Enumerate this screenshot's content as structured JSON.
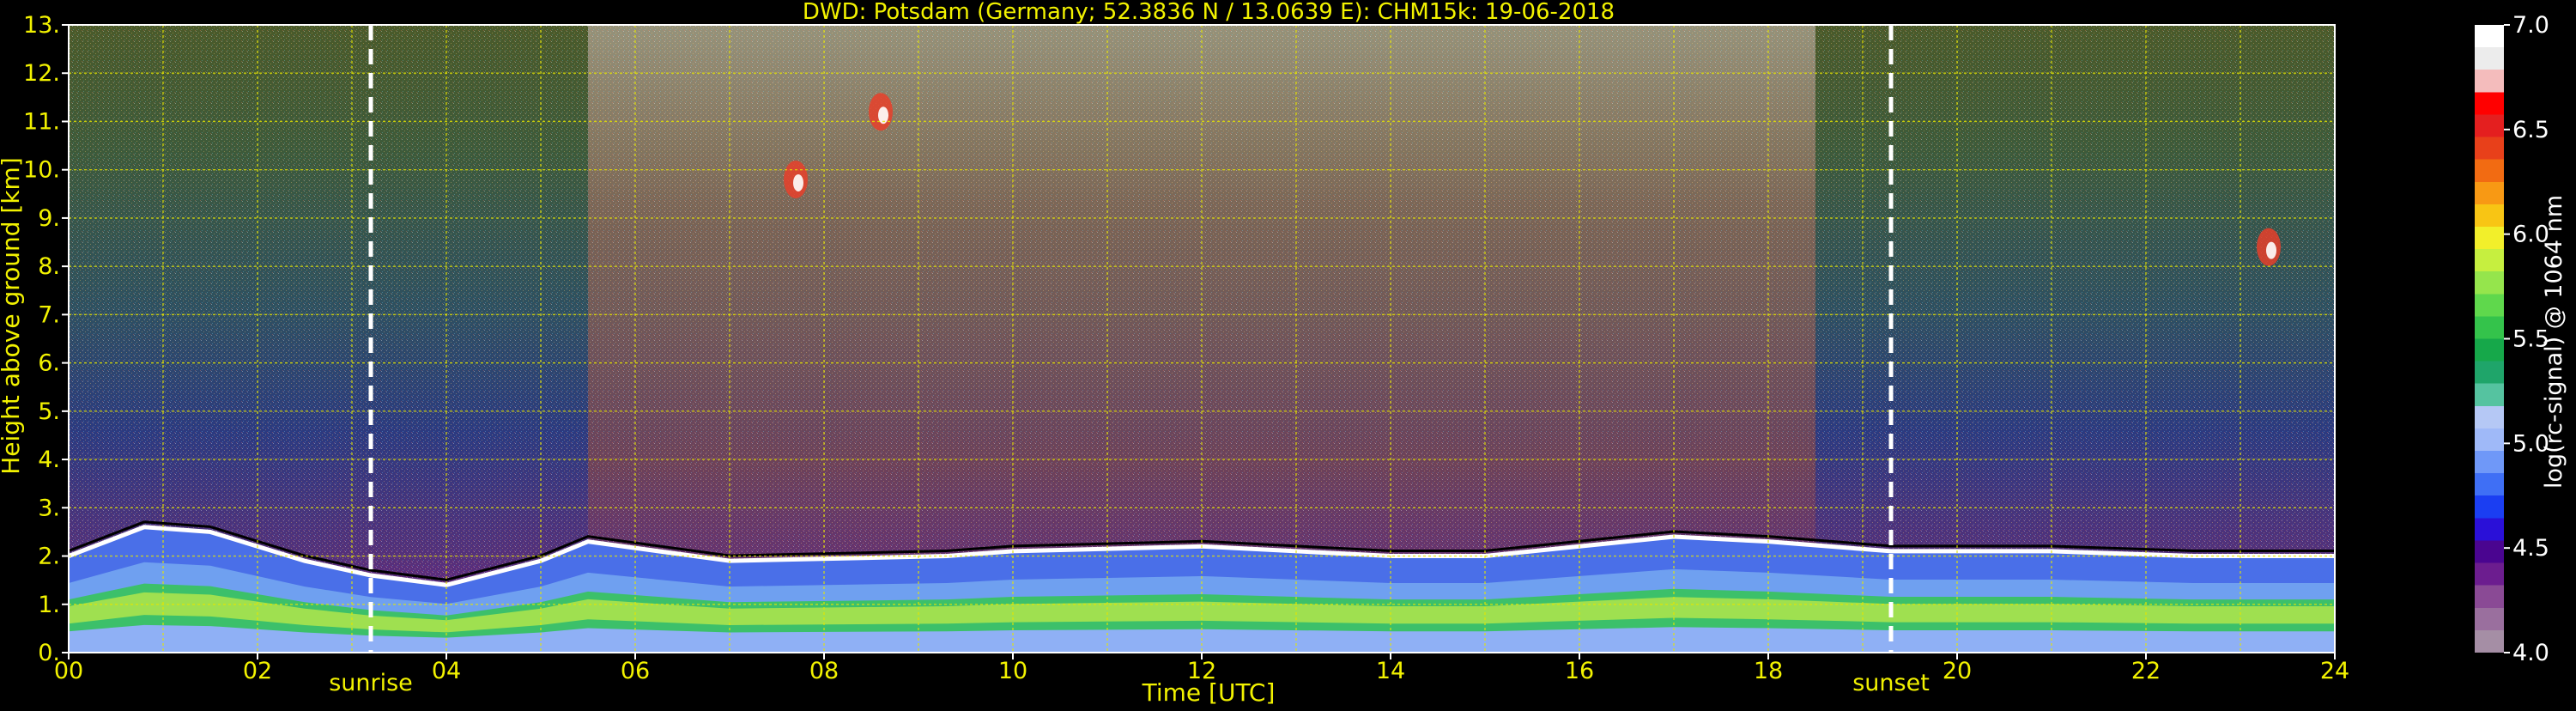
{
  "chart_data": {
    "type": "heatmap",
    "title": "DWD: Potsdam (Germany; 52.3836 N / 13.0639 E):    CHM15k: 19-06-2018",
    "xlabel": "Time [UTC]",
    "ylabel": "Height above ground [km]",
    "xlim": [
      0,
      24
    ],
    "ylim": [
      0,
      13
    ],
    "x_ticks": [
      "00",
      "02",
      "04",
      "06",
      "08",
      "10",
      "12",
      "14",
      "16",
      "18",
      "20",
      "22",
      "24"
    ],
    "y_ticks": [
      "0.",
      "1.",
      "2.",
      "3.",
      "4.",
      "5.",
      "6.",
      "7.",
      "8.",
      "9.",
      "10.",
      "11.",
      "12.",
      "13."
    ],
    "grid": true,
    "annotations": [
      {
        "label": "sunrise",
        "x": 3.2
      },
      {
        "label": "sunset",
        "x": 19.3
      }
    ],
    "colorbar": {
      "label": "log(rc-signal) @ 1064 nm",
      "range": [
        4.0,
        7.0
      ],
      "ticks": [
        "4.0",
        "4.5",
        "5.0",
        "5.5",
        "6.0",
        "6.5",
        "7.0"
      ],
      "colors": [
        "#a58ea5",
        "#9a6f9e",
        "#8a4a95",
        "#6c1d8f",
        "#4a0590",
        "#2a10d8",
        "#1b3ef2",
        "#3f6ff5",
        "#6f98f8",
        "#9fb9f8",
        "#b5c8f5",
        "#55c3a0",
        "#1fa56a",
        "#16a84a",
        "#34c34b",
        "#5fd84c",
        "#95e54c",
        "#c6ef3f",
        "#f2ef2a",
        "#f8c514",
        "#f89914",
        "#f26b12",
        "#e8401a",
        "#e41f1f",
        "#ff0000",
        "#f4bcbc",
        "#ececec",
        "#ffffff"
      ]
    },
    "aerosol_layer_top_km": [
      {
        "t": 0,
        "h": 2.0
      },
      {
        "t": 0.8,
        "h": 2.6
      },
      {
        "t": 1.5,
        "h": 2.5
      },
      {
        "t": 2.5,
        "h": 1.9
      },
      {
        "t": 3.2,
        "h": 1.6
      },
      {
        "t": 4.0,
        "h": 1.4
      },
      {
        "t": 5.0,
        "h": 1.9
      },
      {
        "t": 5.5,
        "h": 2.3
      },
      {
        "t": 7.0,
        "h": 1.9
      },
      {
        "t": 9.3,
        "h": 2.0
      },
      {
        "t": 10.0,
        "h": 2.1
      },
      {
        "t": 12.0,
        "h": 2.2
      },
      {
        "t": 14.0,
        "h": 2.0
      },
      {
        "t": 15.0,
        "h": 2.0
      },
      {
        "t": 16.0,
        "h": 2.2
      },
      {
        "t": 17.0,
        "h": 2.4
      },
      {
        "t": 18.0,
        "h": 2.3
      },
      {
        "t": 19.3,
        "h": 2.1
      },
      {
        "t": 21.0,
        "h": 2.1
      },
      {
        "t": 22.5,
        "h": 2.0
      },
      {
        "t": 24,
        "h": 2.0
      }
    ],
    "cirrus_patches": [
      {
        "t": 23.3,
        "h": 8.4
      },
      {
        "t": 8.6,
        "h": 11.2
      },
      {
        "t": 7.7,
        "h": 9.8
      }
    ]
  }
}
